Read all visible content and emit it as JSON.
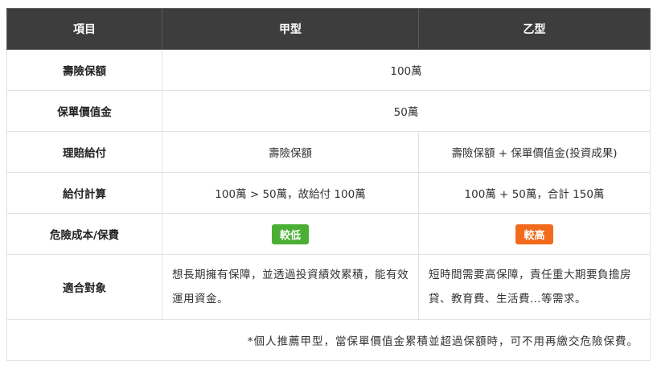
{
  "table": {
    "headers": [
      "項目",
      "甲型",
      "乙型"
    ],
    "rows": {
      "sum_insured": {
        "label": "壽險保額",
        "value": "100萬"
      },
      "cash_value": {
        "label": "保單價值金",
        "value": "50萬"
      },
      "payout": {
        "label": "理賠給付",
        "a": "壽險保額",
        "b": "壽險保額 + 保單價值金(投資成果)"
      },
      "calc": {
        "label": "給付計算",
        "a": "100萬 > 50萬，故給付 100萬",
        "b": "100萬 + 50萬，合計 150萬"
      },
      "risk_cost": {
        "label": "危險成本/保費",
        "a": "較低",
        "b": "較高"
      },
      "suitable": {
        "label": "適合對象",
        "a": "想長期擁有保障，並透過投資績效累積，能有效運用資金。",
        "b": "短時間需要高保障，責任重大期要負擔房貸、教育費、生活費…等需求。"
      }
    },
    "footnote": "*個人推薦甲型，當保單價值金累積並超過保額時，可不用再繳交危險保費。"
  },
  "colors": {
    "header_bg": "#3d3d3d",
    "badge_low": "#4caf35",
    "badge_high": "#f26b1d"
  }
}
